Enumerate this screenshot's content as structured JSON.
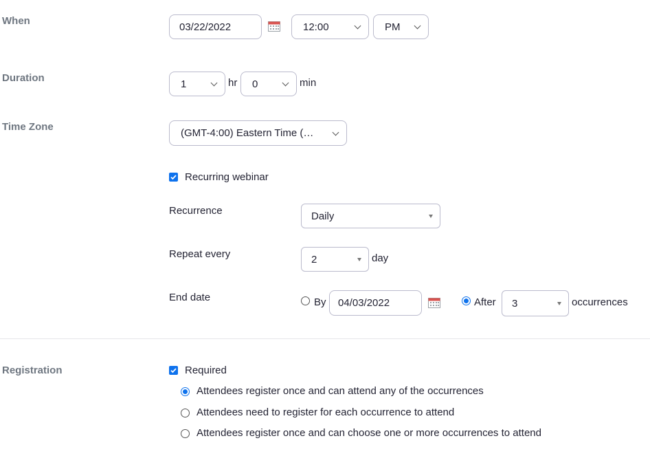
{
  "when": {
    "label": "When",
    "date": "03/22/2022",
    "time": "12:00",
    "ampm": "PM"
  },
  "duration": {
    "label": "Duration",
    "hours": "1",
    "hr_unit": "hr",
    "minutes": "0",
    "min_unit": "min"
  },
  "timezone": {
    "label": "Time Zone",
    "value": "(GMT-4:00) Eastern Time (US and Canada)"
  },
  "recurring": {
    "label": "Recurring webinar",
    "checked": true,
    "recurrence_label": "Recurrence",
    "recurrence_value": "Daily",
    "repeat_label": "Repeat every",
    "repeat_value": "2",
    "repeat_unit": "day",
    "end_label": "End date",
    "by_label": "By",
    "by_date": "04/03/2022",
    "after_label": "After",
    "after_value": "3",
    "occurrences_label": "occurrences",
    "end_mode": "after"
  },
  "registration": {
    "label": "Registration",
    "required_label": "Required",
    "required_checked": true,
    "options": [
      {
        "label": "Attendees register once and can attend any of the occurrences",
        "selected": true
      },
      {
        "label": "Attendees need to register for each occurrence to attend",
        "selected": false
      },
      {
        "label": "Attendees register once and can choose one or more occurrences to attend",
        "selected": false
      }
    ]
  },
  "colors": {
    "accent": "#0e72ed",
    "label_gray": "#6e7680",
    "border": "#babacc"
  }
}
